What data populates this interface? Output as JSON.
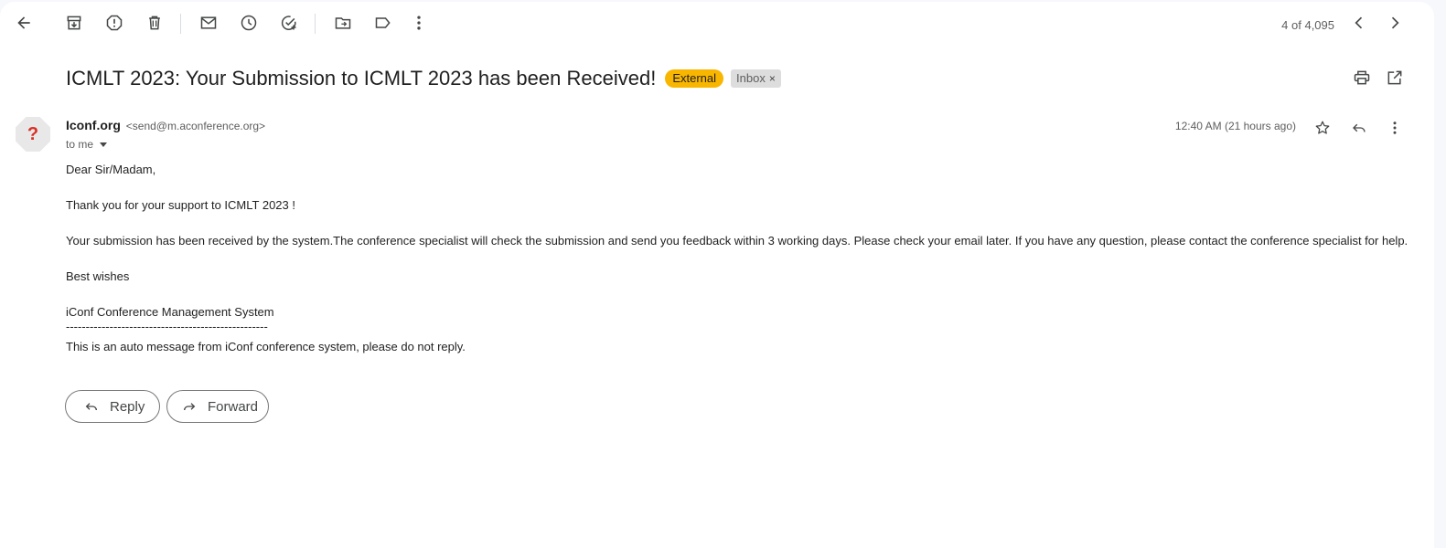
{
  "toolbar": {
    "counter": "4 of 4,095",
    "icons": [
      "back-arrow-icon",
      "archive-icon",
      "report-spam-icon",
      "delete-icon",
      "mark-unread-icon",
      "snooze-icon",
      "add-task-icon",
      "move-to-icon",
      "label-icon",
      "more-vert-icon",
      "prev-chevron-icon",
      "next-chevron-icon"
    ]
  },
  "subject": {
    "title": "ICMLT 2023: Your Submission to ICMLT 2023 has been Received!",
    "external_label": "External",
    "inbox_label": "Inbox",
    "inbox_remove": "×",
    "accent_external": "#f9b600"
  },
  "sender": {
    "avatar_glyph": "?",
    "name": "Iconf.org",
    "email": "<send@m.aconference.org>",
    "to": "to me",
    "timestamp": "12:40 AM (21 hours ago)"
  },
  "body": {
    "greeting": "Dear Sir/Madam,",
    "thanks": "Thank you for your support to ICMLT 2023 !",
    "main": "Your submission has been received by the system.The conference specialist will check the submission and send you feedback within 3 working days. Please check your email later. If you have any question, please contact the conference specialist for help.",
    "closing": "Best wishes",
    "signature": "iConf Conference Management System",
    "divider": "---------------------------------------------------",
    "footer": "This is an auto message from iConf conference system, please do not reply."
  },
  "actions": {
    "reply_label": "Reply",
    "forward_label": "Forward"
  }
}
